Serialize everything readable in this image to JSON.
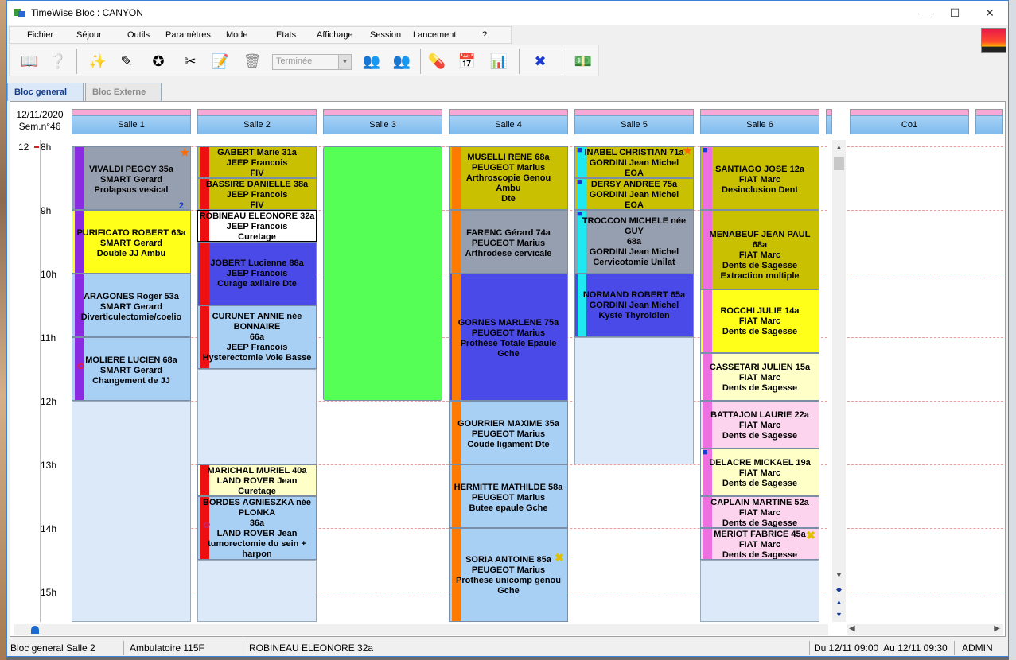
{
  "window": {
    "title": "TimeWise Bloc : CANYON"
  },
  "menu": [
    "Fichier",
    "Séjour",
    "Outils",
    "Paramètres",
    "Mode",
    "Etats",
    "Affichage",
    "Session",
    "Lancement",
    "?"
  ],
  "toolbar": {
    "status_value": "Terminée"
  },
  "tabs": [
    {
      "label": "Bloc general"
    },
    {
      "label": "Bloc Externe"
    }
  ],
  "planning": {
    "date": "12/11/2020",
    "week": "Sem.n°46",
    "current_hour_marker": "12",
    "rooms": [
      "Salle 1",
      "Salle 2",
      "Salle 3",
      "Salle 4",
      "Salle 5",
      "Salle 6",
      "Co1"
    ],
    "hours": [
      "8h",
      "9h",
      "10h",
      "11h",
      "12h",
      "13h",
      "14h",
      "15h"
    ],
    "blocks": {
      "b1": [
        "VIVALDI PEGGY 35a",
        "SMART Gerard",
        "Prolapsus vesical"
      ],
      "b2": [
        "PURIFICATO ROBERT 63a",
        "SMART Gerard",
        "Double JJ Ambu"
      ],
      "b3": [
        "ARAGONES Roger 53a",
        "SMART Gerard",
        "Diverticulectomie/coelio"
      ],
      "b4": [
        "MOLIERE LUCIEN 68a",
        "SMART Gerard",
        "Changement de JJ"
      ],
      "b5": [
        "GABERT Marie 31a",
        "JEEP Francois",
        "FIV"
      ],
      "b6": [
        "BASSIRE DANIELLE 38a",
        "JEEP Francois",
        "FIV"
      ],
      "b7": [
        "ROBINEAU ELEONORE 32a",
        "JEEP Francois",
        "Curetage"
      ],
      "b8": [
        "JOBERT Lucienne 88a",
        "JEEP Francois",
        "Curage axilaire Dte"
      ],
      "b9": [
        "CURUNET ANNIE née",
        "BONNAIRE",
        "66a",
        "JEEP Francois",
        "Hysterectomie Voie Basse"
      ],
      "b10": [
        "MARICHAL MURIEL 40a",
        "LAND ROVER Jean",
        "Curetage"
      ],
      "b11": [
        "BORDES AGNIESZKA née",
        "PLONKA",
        "36a",
        "LAND ROVER Jean",
        "tumorectomie du sein +",
        "harpon"
      ],
      "b12": [
        "MUSELLI RENE 68a",
        "PEUGEOT Marius",
        "Arthroscopie Genou",
        "Ambu",
        "Dte"
      ],
      "b13": [
        "FARENC Gérard 74a",
        "PEUGEOT Marius",
        "Arthrodese cervicale"
      ],
      "b14": [
        "GORNES MARLENE 75a",
        "PEUGEOT Marius",
        "Prothèse Totale Epaule",
        "Gche"
      ],
      "b15": [
        "GOURRIER MAXIME 35a",
        "PEUGEOT Marius",
        "Coude ligament Dte"
      ],
      "b16": [
        "HERMITTE MATHILDE 58a",
        "PEUGEOT Marius",
        "Butee epaule Gche"
      ],
      "b17": [
        "SORIA ANTOINE 85a",
        "PEUGEOT Marius",
        "Prothese unicomp genou",
        "Gche"
      ],
      "b18": [
        "INABEL CHRISTIAN 71a",
        "GORDINI Jean Michel",
        "EOA"
      ],
      "b19": [
        "DERSY ANDREE 75a",
        "GORDINI Jean Michel",
        "EOA"
      ],
      "b20": [
        "TROCCON MICHELE née",
        "GUY",
        "68a",
        "GORDINI Jean Michel",
        "Cervicotomie Unilat"
      ],
      "b21": [
        "NORMAND ROBERT 65a",
        "GORDINI Jean Michel",
        "Kyste Thyroidien"
      ],
      "b22": [
        "SANTIAGO JOSE 12a",
        "FIAT Marc",
        "Desinclusion Dent"
      ],
      "b23": [
        "MENABEUF JEAN PAUL 68a",
        "FIAT Marc",
        "Dents de Sagesse",
        "Extraction multiple"
      ],
      "b24": [
        "ROCCHI JULIE 14a",
        "FIAT Marc",
        "Dents de Sagesse"
      ],
      "b25": [
        "CASSETARI JULIEN 15a",
        "FIAT Marc",
        "Dents de Sagesse"
      ],
      "b26": [
        "BATTAJON LAURIE 22a",
        "FIAT Marc",
        "Dents de Sagesse"
      ],
      "b27": [
        "DELACRE MICKAEL 19a",
        "FIAT Marc",
        "Dents de Sagesse"
      ],
      "b28": [
        "CAPLAIN MARTINE 52a",
        "FIAT Marc",
        "Dents de Sagesse"
      ],
      "b29": [
        "MERIOT FABRICE 45a",
        "FIAT Marc",
        "Dents de Sagesse"
      ]
    },
    "badge_count": "2"
  },
  "statusbar": {
    "location": "Bloc general Salle 2",
    "service": "Ambulatoire 115F",
    "patient": "ROBINEAU ELEONORE 32a",
    "period": "Du 12/11 09:00  Au 12/11 09:30",
    "user": "ADMIN"
  }
}
